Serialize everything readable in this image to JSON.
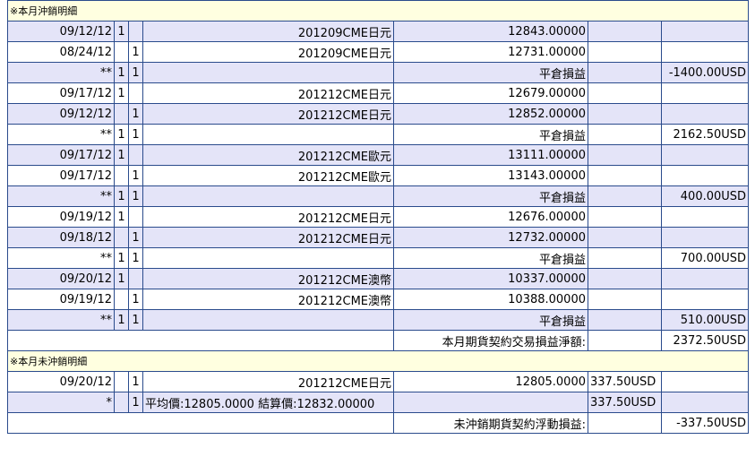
{
  "section1": {
    "title": "※本月沖銷明細",
    "rows": [
      {
        "date": "09/12/12",
        "b": "1",
        "s": "",
        "desc": "201209CME日元",
        "price": "12843.00000",
        "pnl": "",
        "amount": "",
        "alt": true
      },
      {
        "date": "08/24/12",
        "b": "",
        "s": "1",
        "desc": "201209CME日元",
        "price": "12731.00000",
        "pnl": "",
        "amount": "",
        "alt": false
      },
      {
        "date": "**",
        "b": "1",
        "s": "1",
        "desc": "",
        "price": "平倉損益",
        "pnl": "",
        "amount": "-1400.00USD",
        "alt": true
      },
      {
        "date": "09/17/12",
        "b": "1",
        "s": "",
        "desc": "201212CME日元",
        "price": "12679.00000",
        "pnl": "",
        "amount": "",
        "alt": false
      },
      {
        "date": "09/12/12",
        "b": "",
        "s": "1",
        "desc": "201212CME日元",
        "price": "12852.00000",
        "pnl": "",
        "amount": "",
        "alt": true
      },
      {
        "date": "**",
        "b": "1",
        "s": "1",
        "desc": "",
        "price": "平倉損益",
        "pnl": "",
        "amount": "2162.50USD",
        "alt": false
      },
      {
        "date": "09/17/12",
        "b": "1",
        "s": "",
        "desc": "201212CME歐元",
        "price": "13111.00000",
        "pnl": "",
        "amount": "",
        "alt": true
      },
      {
        "date": "09/17/12",
        "b": "",
        "s": "1",
        "desc": "201212CME歐元",
        "price": "13143.00000",
        "pnl": "",
        "amount": "",
        "alt": false
      },
      {
        "date": "**",
        "b": "1",
        "s": "1",
        "desc": "",
        "price": "平倉損益",
        "pnl": "",
        "amount": "400.00USD",
        "alt": true
      },
      {
        "date": "09/19/12",
        "b": "1",
        "s": "",
        "desc": "201212CME日元",
        "price": "12676.00000",
        "pnl": "",
        "amount": "",
        "alt": false
      },
      {
        "date": "09/18/12",
        "b": "",
        "s": "1",
        "desc": "201212CME日元",
        "price": "12732.00000",
        "pnl": "",
        "amount": "",
        "alt": true
      },
      {
        "date": "**",
        "b": "1",
        "s": "1",
        "desc": "",
        "price": "平倉損益",
        "pnl": "",
        "amount": "700.00USD",
        "alt": false
      },
      {
        "date": "09/20/12",
        "b": "1",
        "s": "",
        "desc": "201212CME澳幣",
        "price": "10337.00000",
        "pnl": "",
        "amount": "",
        "alt": true
      },
      {
        "date": "09/19/12",
        "b": "",
        "s": "1",
        "desc": "201212CME澳幣",
        "price": "10388.00000",
        "pnl": "",
        "amount": "",
        "alt": false
      },
      {
        "date": "**",
        "b": "1",
        "s": "1",
        "desc": "",
        "price": "平倉損益",
        "pnl": "",
        "amount": "510.00USD",
        "alt": true
      }
    ],
    "total_label": "本月期貨契約交易損益淨額:",
    "total_value": "2372.50USD"
  },
  "section2": {
    "title": "※本月未沖銷明細",
    "row1": {
      "date": "09/20/12",
      "b": "",
      "s": "1",
      "desc": "201212CME日元",
      "price": "12805.0000",
      "pnl": "337.50USD",
      "amount": ""
    },
    "row2": {
      "date": "*",
      "b": "",
      "s": "1",
      "desc": "平均價:12805.0000 結算價:12832.00000",
      "pnl": "337.50USD",
      "amount": ""
    },
    "total_label": "未沖銷期貨契約浮動損益:",
    "total_value": "-337.50USD"
  }
}
